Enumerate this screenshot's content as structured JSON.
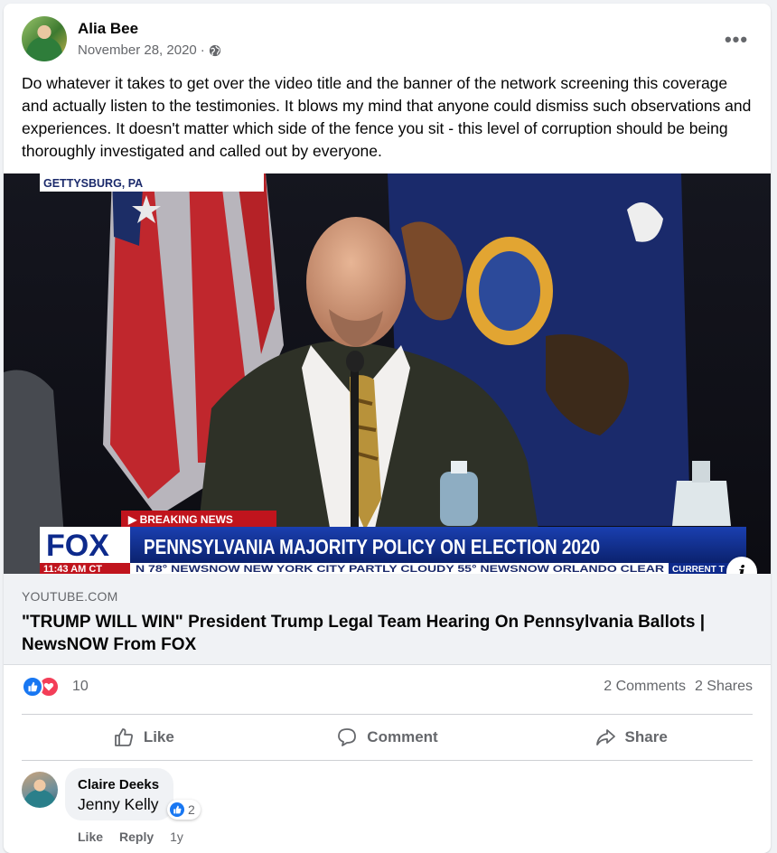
{
  "post": {
    "author": "Alia Bee",
    "date": "November 28, 2020",
    "separator": "·",
    "body": "Do whatever it takes to get over the video title and the banner of the network screening this coverage and actually listen to the testimonies. It blows my mind that anyone could dismiss such observations and experiences. It doesn't matter which side of the fence you sit - this level of corruption should be being thoroughly investigated and called out by everyone.",
    "more_label": "•••"
  },
  "video": {
    "location_tag": "GETTYSBURG, PA",
    "breaking": "▶ BREAKING NEWS",
    "network_logo": "FOX",
    "headline": "PENNSYLVANIA MAJORITY POLICY ON ELECTION 2020",
    "time": "11:43 AM CT",
    "ticker": "N 78°   NEWSNOW   NEW YORK CITY   PARTLY CLOUDY 55°   NEWSNOW   ORLANDO   CLEAR",
    "ticker_tag": "CURRENT T",
    "info_label": "i"
  },
  "link": {
    "domain": "YOUTUBE.COM",
    "title": "\"TRUMP WILL WIN\" President Trump Legal Team Hearing On Pennsylvania Ballots | NewsNOW From FOX"
  },
  "stats": {
    "reaction_count": "10",
    "comments": "2 Comments",
    "shares": "2 Shares"
  },
  "actions": {
    "like": "Like",
    "comment": "Comment",
    "share": "Share"
  },
  "comment": {
    "author": "Claire Deeks",
    "text": "Jenny Kelly",
    "reaction_count": "2",
    "like": "Like",
    "reply": "Reply",
    "time": "1y"
  },
  "colors": {
    "facebook_blue": "#1877f2",
    "love_red": "#f33e58",
    "muted_text": "#65676b",
    "fox_blue": "#0d2a8c"
  }
}
